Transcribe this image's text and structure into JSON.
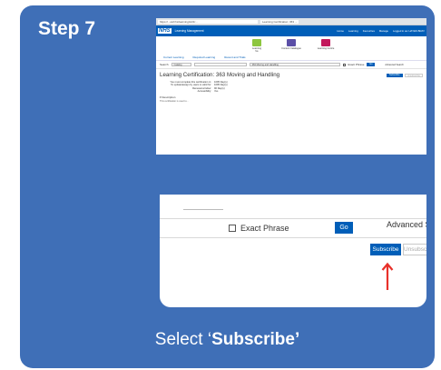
{
  "slide": {
    "step_title": "Step 7",
    "caption_prefix": "Select ‘",
    "caption_bold": "Subscribe’",
    "background_color": "#3f6fb7",
    "arrow_color": "#e8312a"
  },
  "screenshot": {
    "browser_url": "https://...uk/nhs/learning/s/21/...",
    "browser_tab": "Learning Certification: 363 ...",
    "header": {
      "logo": "NHS",
      "title": "Learning Management",
      "nav": [
        "Home",
        "Learning",
        "Favourites",
        "Manage"
      ],
      "user": "Logged in as: HAYES BRAY"
    },
    "tiles": [
      {
        "label": "Learning",
        "sub": "Me",
        "color": "#8dc63f"
      },
      {
        "label": "Content Catalogue",
        "sub": "",
        "color": "#5b4fa7"
      },
      {
        "label": "Learning Centre",
        "sub": "",
        "color": "#c2185b"
      }
    ],
    "subtabs": [
      "Current Learning",
      "Required Learning",
      "Recent and Trials"
    ],
    "search": {
      "search_in_label": "Search",
      "search_in_value": "Catalog",
      "query": "363 Moving and Handling",
      "exact_phrase": "Exact Phrase",
      "go": "Go",
      "advanced": "Advanced Search"
    },
    "page_title": "Learning Certification: 363 Moving and Handling",
    "subscribe": "Subscribe",
    "unsubscribe": "Unsubscribe",
    "details": [
      {
        "k": "You must complete this certification in:",
        "v": "1095  Day(s)"
      },
      {
        "k": "To update/assign by users is valid for:",
        "v": "1095  Day(s)"
      },
      {
        "k": "Renewal window:",
        "v": "90  Day(s)"
      },
      {
        "k": "Accessibility:",
        "v": "Yes"
      }
    ],
    "description_label": "Description",
    "description_text": "This certification is used to..."
  },
  "zoom": {
    "exact_phrase": "Exact Phrase",
    "go": "Go",
    "advanced": "Advanced Search",
    "subscribe": "Subscribe",
    "unsubscribe": "Unsubscribe"
  }
}
